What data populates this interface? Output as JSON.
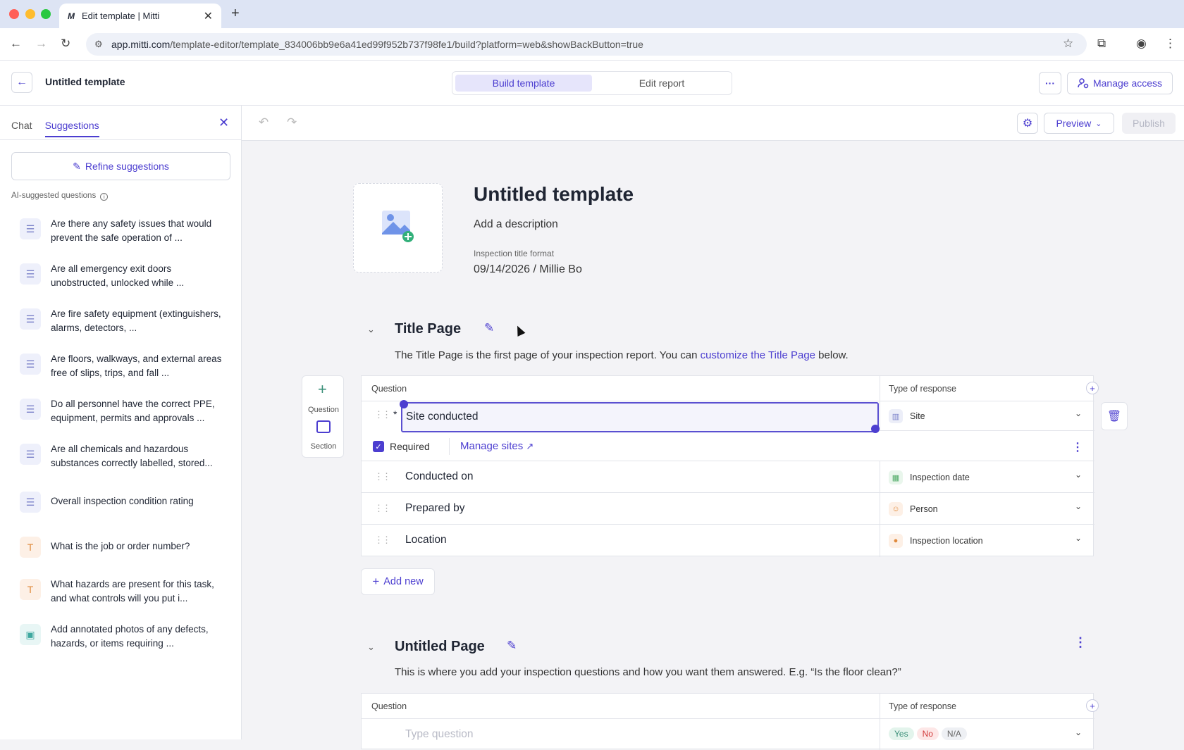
{
  "browser": {
    "tab_title": "Edit template | Mitti",
    "tab_favicon": "M",
    "url_host": "app.mitti.com",
    "url_path": "/template-editor/template_834006bb9e6a41ed99f952b737f98fe1/build?platform=web&showBackButton=true"
  },
  "header": {
    "title": "Untitled template",
    "tabs": [
      "Build template",
      "Edit report"
    ],
    "more_label": "···",
    "manage_access_label": "Manage access"
  },
  "sidebar": {
    "tabs": [
      "Chat",
      "Suggestions"
    ],
    "refine_label": "Refine suggestions",
    "section_label": "AI-suggested questions",
    "items": [
      {
        "icon": "list-icon",
        "text": "Are there any safety issues that would prevent the safe operation of ..."
      },
      {
        "icon": "list-icon",
        "text": "Are all emergency exit doors unobstructed, unlocked while ..."
      },
      {
        "icon": "list-icon",
        "text": "Are fire safety equipment (extinguishers, alarms, detectors, ..."
      },
      {
        "icon": "list-icon",
        "text": "Are floors, walkways, and external areas free of slips, trips, and fall ..."
      },
      {
        "icon": "list-icon",
        "text": "Do all personnel have the correct PPE, equipment, permits and approvals ..."
      },
      {
        "icon": "list-icon",
        "text": "Are all chemicals and hazardous substances correctly labelled, stored..."
      },
      {
        "icon": "list-icon",
        "text": "Overall inspection condition rating"
      },
      {
        "icon": "text-icon",
        "text": "What is the job or order number?"
      },
      {
        "icon": "text-icon",
        "text": "What hazards are present for this task, and what controls will you put i..."
      },
      {
        "icon": "photo-icon",
        "text": "Add annotated photos of any defects, hazards, or items requiring ..."
      }
    ]
  },
  "toolbar": {
    "preview_label": "Preview",
    "publish_label": "Publish"
  },
  "template": {
    "title": "Untitled template",
    "description": "Add a description",
    "title_format_label": "Inspection title format",
    "title_format_value": "09/14/2026 / Millie Bo"
  },
  "title_page": {
    "title": "Title Page",
    "desc_pre": "The Title Page is the first page of your inspection report. You can ",
    "desc_link": "customize the Title Page",
    "desc_post": " below.",
    "col_question": "Question",
    "col_response": "Type of response",
    "rows": [
      {
        "question": "Site conducted",
        "response": "Site",
        "required": true
      },
      {
        "question": "Conducted on",
        "response": "Inspection date"
      },
      {
        "question": "Prepared by",
        "response": "Person"
      },
      {
        "question": "Location",
        "response": "Inspection location"
      }
    ],
    "required_label": "Required",
    "manage_sites_label": "Manage sites",
    "add_new_label": "Add new"
  },
  "add_panel": {
    "question_label": "Question",
    "section_label": "Section"
  },
  "untitled_page": {
    "title": "Untitled Page",
    "desc": "This is where you add your inspection questions and how you want them answered. E.g. “Is the floor clean?”",
    "col_question": "Question",
    "col_response": "Type of response",
    "placeholder": "Type question",
    "pills": [
      "Yes",
      "No",
      "N/A"
    ]
  },
  "colors": {
    "accent": "#4c3ed0",
    "green": "#3a8f78"
  }
}
